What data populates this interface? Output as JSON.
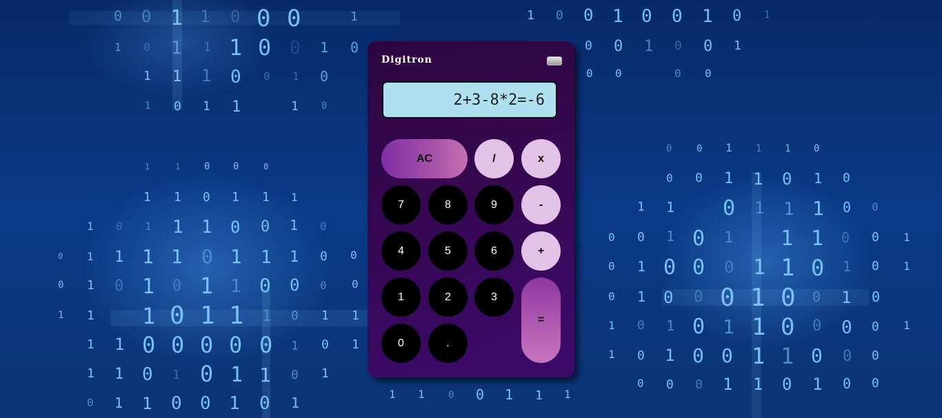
{
  "calculator": {
    "brand": "Digitron",
    "display": "2+3-8*2=-6",
    "solar_panel_icon": "solar-panel-icon",
    "buttons": {
      "ac": "AC",
      "divide": "/",
      "multiply": "x",
      "seven": "7",
      "eight": "8",
      "nine": "9",
      "minus": "-",
      "four": "4",
      "five": "5",
      "six": "6",
      "plus": "+",
      "one": "1",
      "two": "2",
      "three": "3",
      "equals": "=",
      "zero": "0",
      "decimal": "."
    }
  },
  "colors": {
    "display_bg": "#aee0ef",
    "body_top": "#2c0640",
    "body_bottom": "#3c0a6c",
    "number_key": "#000000",
    "operator_key": "#e2c2e6",
    "accent_gradient_start": "#7e2fa6",
    "accent_gradient_end": "#c571b0",
    "background": "#0a3a86"
  }
}
